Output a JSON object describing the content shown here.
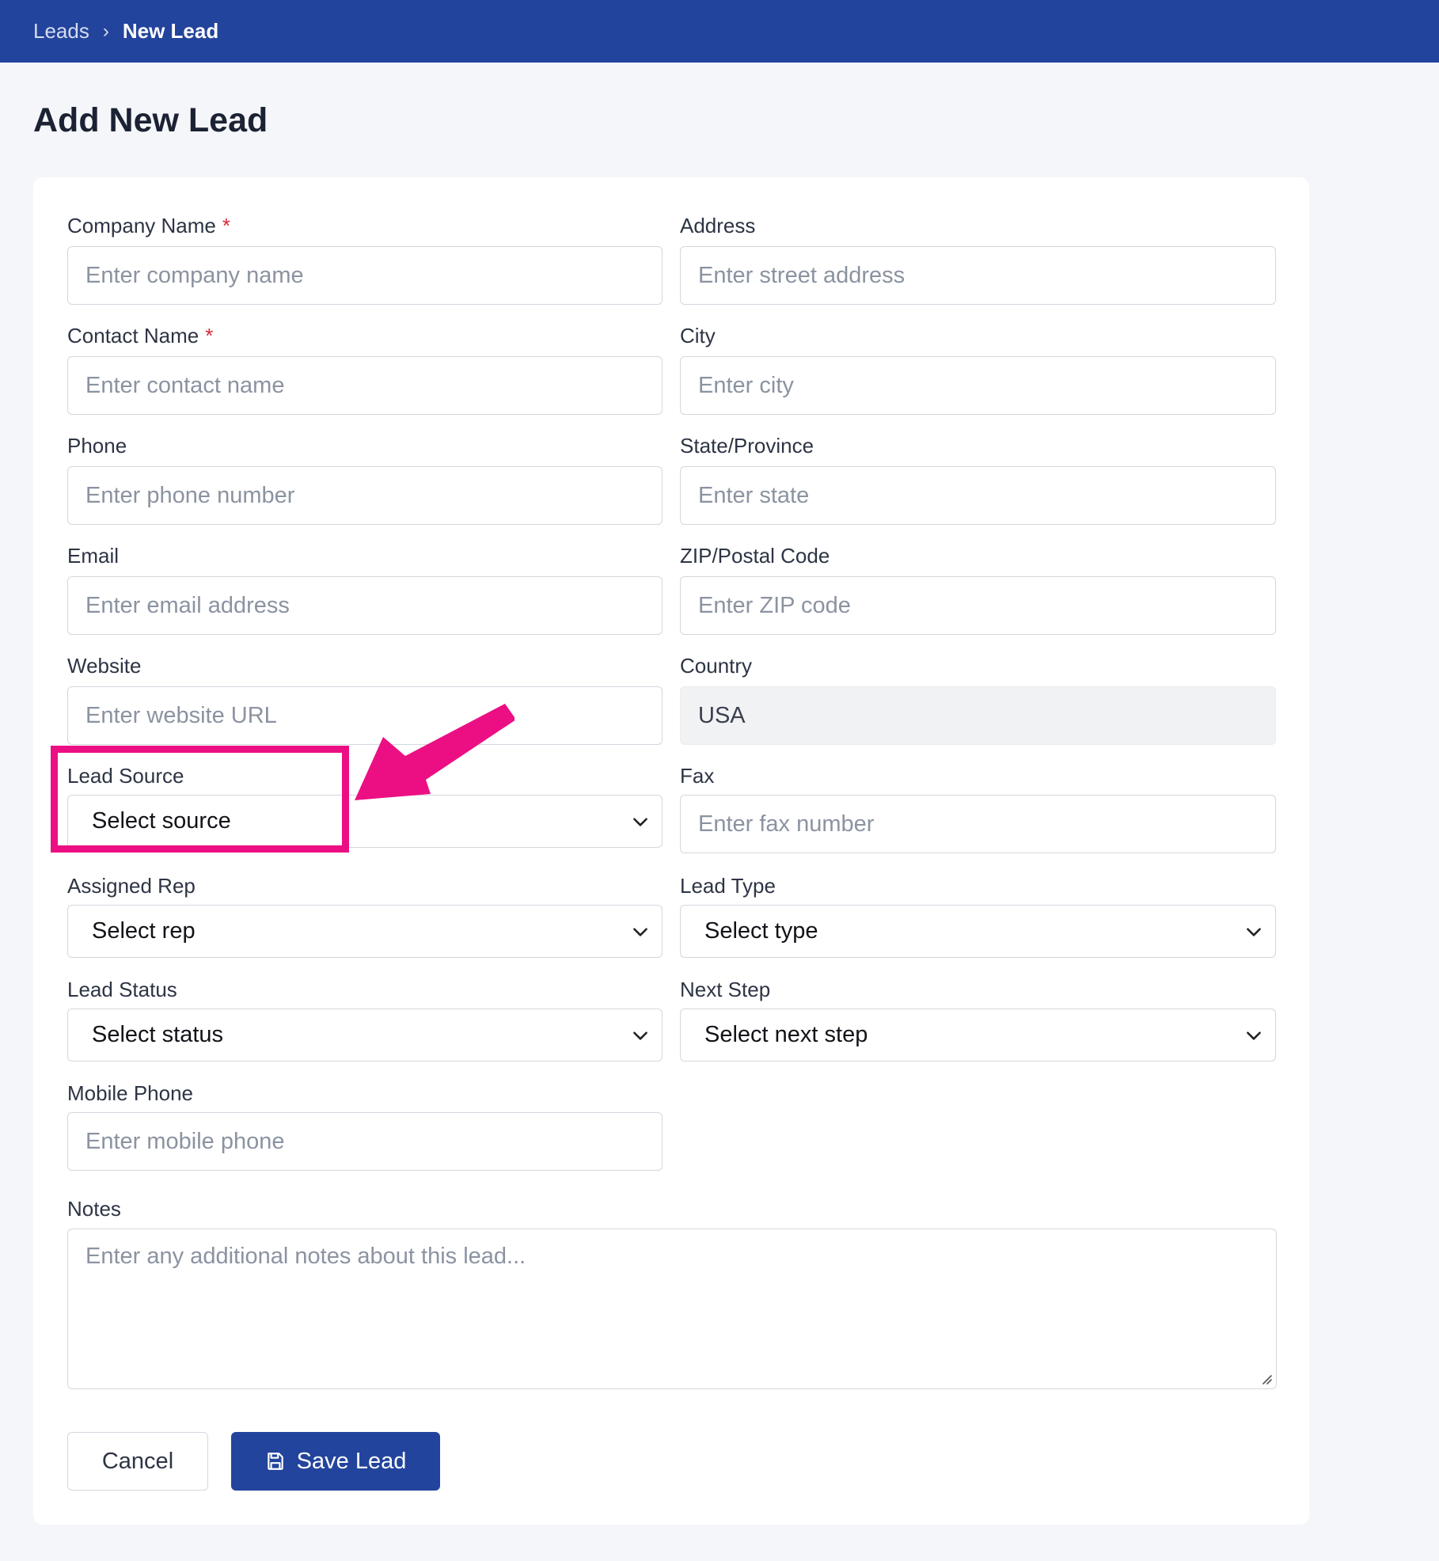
{
  "breadcrumb": {
    "items": [
      "Leads",
      "New Lead"
    ],
    "separator": "›"
  },
  "page": {
    "title": "Add New Lead"
  },
  "form": {
    "company_name": {
      "label": "Company Name",
      "required_mark": "*",
      "placeholder": "Enter company name",
      "value": ""
    },
    "contact_name": {
      "label": "Contact Name",
      "required_mark": "*",
      "placeholder": "Enter contact name",
      "value": ""
    },
    "phone": {
      "label": "Phone",
      "placeholder": "Enter phone number",
      "value": ""
    },
    "email": {
      "label": "Email",
      "placeholder": "Enter email address",
      "value": ""
    },
    "website": {
      "label": "Website",
      "placeholder": "Enter website URL",
      "value": ""
    },
    "lead_source": {
      "label": "Lead Source",
      "selected": "Select source"
    },
    "assigned_rep": {
      "label": "Assigned Rep",
      "selected": "Select rep"
    },
    "lead_status": {
      "label": "Lead Status",
      "selected": "Select status"
    },
    "mobile_phone": {
      "label": "Mobile Phone",
      "placeholder": "Enter mobile phone",
      "value": ""
    },
    "address": {
      "label": "Address",
      "placeholder": "Enter street address",
      "value": ""
    },
    "city": {
      "label": "City",
      "placeholder": "Enter city",
      "value": ""
    },
    "state": {
      "label": "State/Province",
      "placeholder": "Enter state",
      "value": ""
    },
    "zip": {
      "label": "ZIP/Postal Code",
      "placeholder": "Enter ZIP code",
      "value": ""
    },
    "country": {
      "label": "Country",
      "value": "USA"
    },
    "fax": {
      "label": "Fax",
      "placeholder": "Enter fax number",
      "value": ""
    },
    "lead_type": {
      "label": "Lead Type",
      "selected": "Select type"
    },
    "next_step": {
      "label": "Next Step",
      "selected": "Select next step"
    },
    "notes": {
      "label": "Notes",
      "placeholder": "Enter any additional notes about this lead...",
      "value": ""
    }
  },
  "actions": {
    "cancel_label": "Cancel",
    "save_label": "Save Lead"
  },
  "icons": {
    "save": "floppy-disk-icon",
    "select": "chevron-down-icon",
    "resize": "resize-grip-icon"
  },
  "annotation": {
    "color": "#ec0f83",
    "target": "lead_source"
  },
  "colors": {
    "brand": "#23449c",
    "required": "#d82a3a",
    "page_bg": "#f5f6fa"
  }
}
